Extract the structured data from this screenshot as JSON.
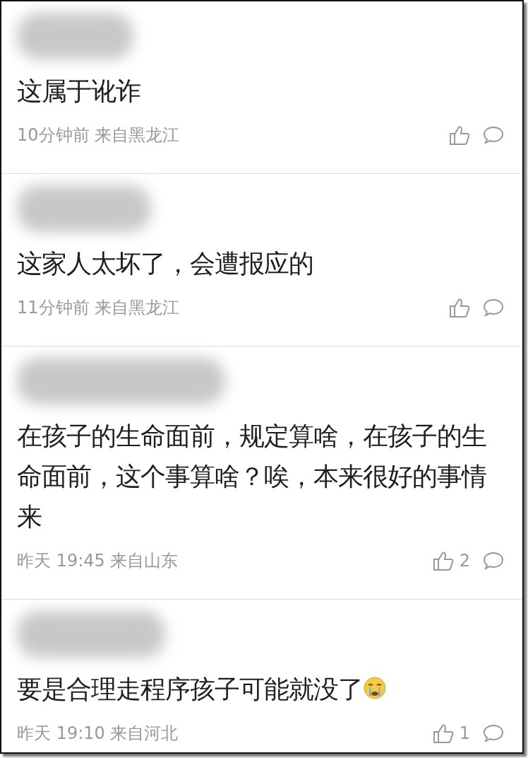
{
  "comments": [
    {
      "text": "这属于讹诈",
      "meta": "10分钟前 来自黑龙江",
      "emoji": false
    },
    {
      "text": "这家人太坏了，会遭报应的",
      "meta": "11分钟前 来自黑龙江",
      "emoji": false
    },
    {
      "text": "在孩子的生命面前，规定算啥，在孩子的生命面前，这个事算啥？唉，本来很好的事情来",
      "meta": "昨天 19:45 来自山东",
      "likes": "2",
      "emoji": false
    },
    {
      "text": "要是合理走程序孩子可能就没了",
      "meta": "昨天 19:10 来自河北",
      "likes": "1",
      "emoji": true
    }
  ]
}
